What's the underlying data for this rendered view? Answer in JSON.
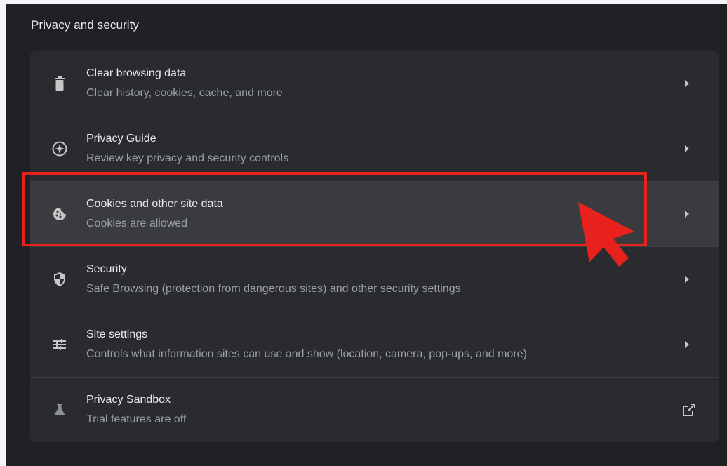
{
  "section": {
    "title": "Privacy and security"
  },
  "rows": [
    {
      "title": "Clear browsing data",
      "subtitle": "Clear history, cookies, cache, and more",
      "icon": "trash-icon",
      "action": "chevron-right"
    },
    {
      "title": "Privacy Guide",
      "subtitle": "Review key privacy and security controls",
      "icon": "compass-icon",
      "action": "chevron-right"
    },
    {
      "title": "Cookies and other site data",
      "subtitle": "Cookies are allowed",
      "icon": "cookie-icon",
      "action": "chevron-right"
    },
    {
      "title": "Security",
      "subtitle": "Safe Browsing (protection from dangerous sites) and other security settings",
      "icon": "shield-icon",
      "action": "chevron-right"
    },
    {
      "title": "Site settings",
      "subtitle": "Controls what information sites can use and show (location, camera, pop-ups, and more)",
      "icon": "tune-icon",
      "action": "chevron-right"
    },
    {
      "title": "Privacy Sandbox",
      "subtitle": "Trial features are off",
      "icon": "flask-icon",
      "action": "external-link"
    }
  ],
  "colors": {
    "background": "#202124",
    "card": "#2a2b2e",
    "highlighted_row": "#3a3b3e",
    "annotation": "#e8211d",
    "primary_text": "#e8eaed",
    "secondary_text": "#9aa0a6"
  }
}
